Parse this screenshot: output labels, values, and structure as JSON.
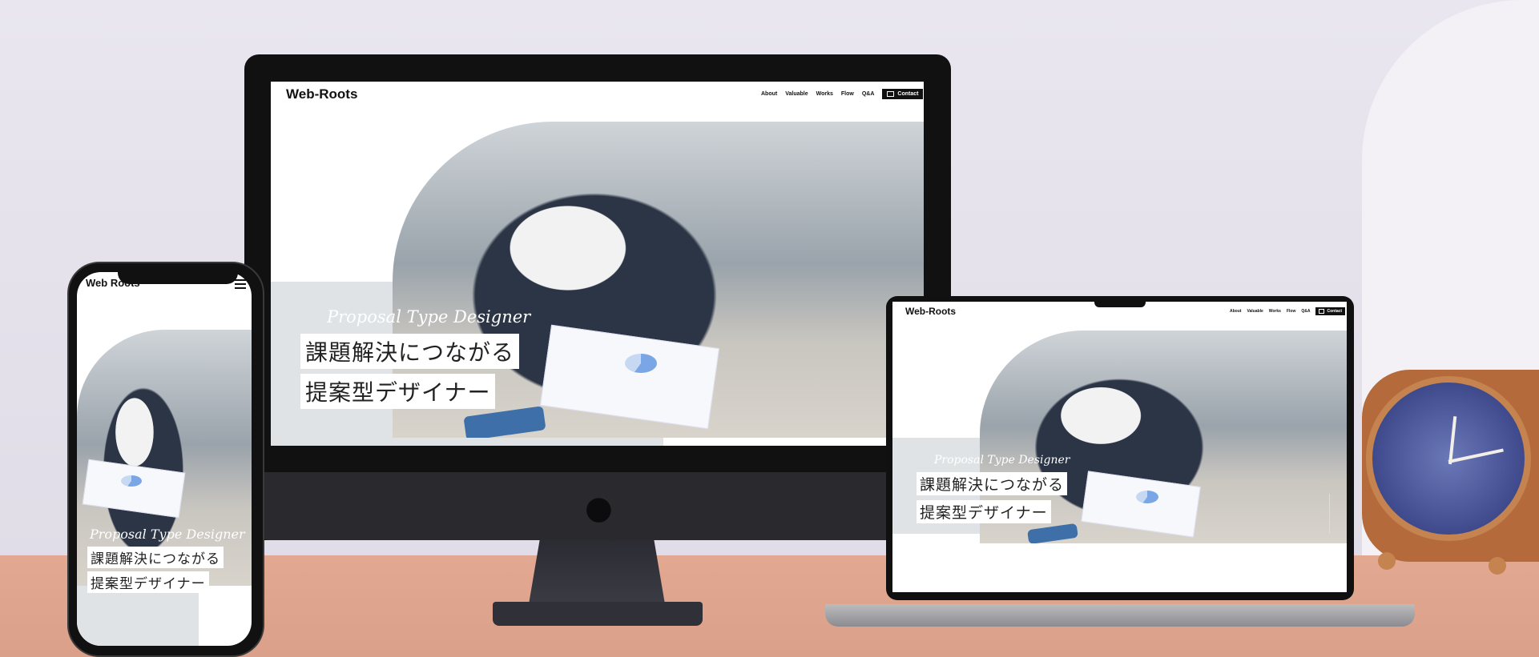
{
  "site": {
    "logo": "Web-Roots",
    "phone_logo": "Web  Roots",
    "nav": [
      "About",
      "Valuable",
      "Works",
      "Flow",
      "Q&A"
    ],
    "contact_label": "Contact",
    "tagline_script": "Proposal Type Designer",
    "headline_line1": "課題解決につながる",
    "headline_line2": "提案型デザイナー"
  },
  "icons": {
    "mail": "mail-icon",
    "menu": "hamburger-menu-icon",
    "apple": "apple-logo-icon"
  },
  "colors": {
    "wall": "#e4e0ea",
    "table": "#dba08a",
    "band": "#dfe3e6",
    "contact_bg": "#111111"
  }
}
